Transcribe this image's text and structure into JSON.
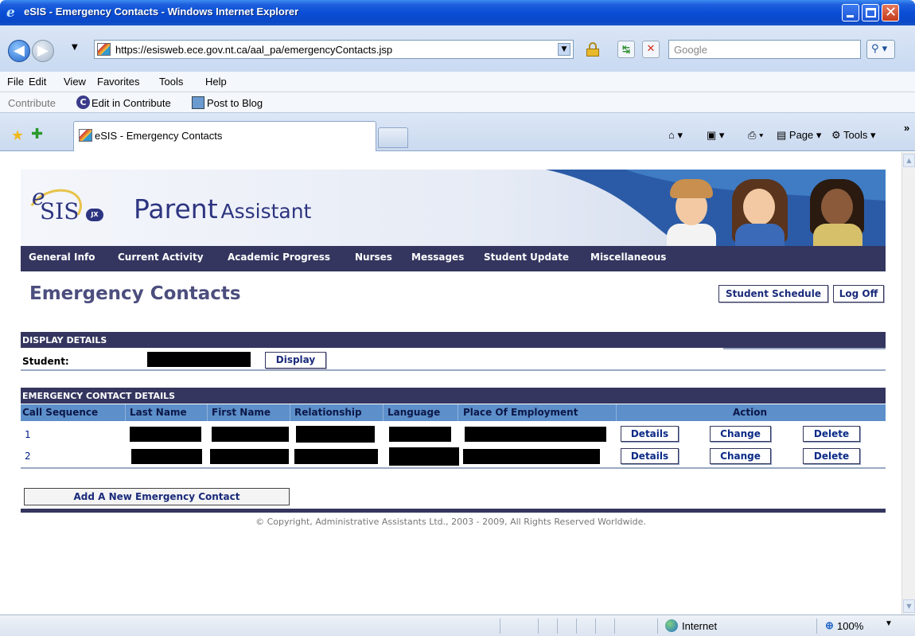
{
  "window": {
    "title": "eSIS - Emergency Contacts - Windows Internet Explorer"
  },
  "address": {
    "url": "https://esisweb.ece.gov.nt.ca/aal_pa/emergencyContacts.jsp",
    "search_placeholder": "Google"
  },
  "menu": [
    "File",
    "Edit",
    "View",
    "Favorites",
    "Tools",
    "Help"
  ],
  "contribute": {
    "label": "Contribute",
    "edit": "Edit in Contribute",
    "post": "Post to Blog"
  },
  "tab": {
    "label": "eSIS - Emergency Contacts"
  },
  "commandbar": {
    "page": "Page",
    "tools": "Tools"
  },
  "banner": {
    "logo_text": "SIS",
    "logo_e": "e",
    "logo_badge": "JX",
    "title_big": "Parent",
    "title_small": "Assistant"
  },
  "nav": [
    "General Info",
    "Current Activity",
    "Academic Progress",
    "Nurses",
    "Messages",
    "Student Update",
    "Miscellaneous"
  ],
  "page": {
    "title": "Emergency Contacts",
    "student_schedule": "Student Schedule",
    "log_off": "Log Off"
  },
  "display_details": {
    "heading": "DISPLAY DETAILS",
    "student_label": "Student:",
    "display_button": "Display"
  },
  "contacts": {
    "heading": "EMERGENCY CONTACT DETAILS",
    "columns": [
      "Call Sequence",
      "Last Name",
      "First Name",
      "Relationship",
      "Language",
      "Place Of Employment",
      "Action"
    ],
    "rows": [
      {
        "seq": "1",
        "details": "Details",
        "change": "Change",
        "delete": "Delete"
      },
      {
        "seq": "2",
        "details": "Details",
        "change": "Change",
        "delete": "Delete"
      }
    ],
    "add_button": "Add A New Emergency Contact"
  },
  "footer": {
    "copyright": "© Copyright, Administrative Assistants Ltd., 2003 - 2009, All Rights Reserved Worldwide."
  },
  "status": {
    "zone": "Internet",
    "zoom": "100%"
  }
}
